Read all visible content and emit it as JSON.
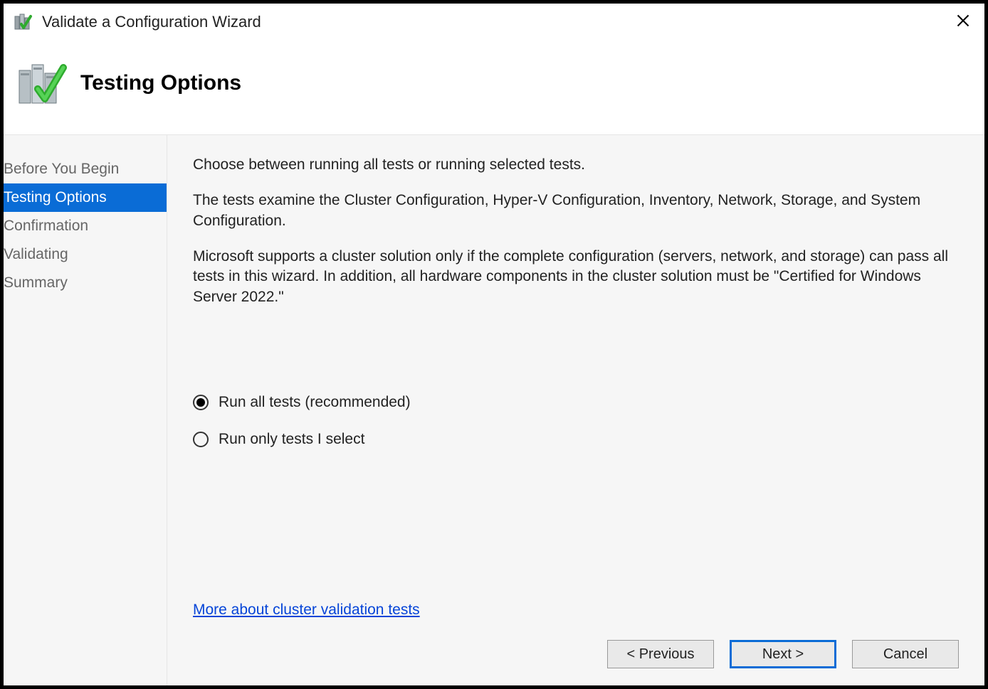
{
  "window": {
    "title": "Validate a Configuration Wizard"
  },
  "header": {
    "title": "Testing Options"
  },
  "sidebar": {
    "items": [
      {
        "label": "Before You Begin",
        "active": false
      },
      {
        "label": "Testing Options",
        "active": true
      },
      {
        "label": "Confirmation",
        "active": false
      },
      {
        "label": "Validating",
        "active": false
      },
      {
        "label": "Summary",
        "active": false
      }
    ]
  },
  "main": {
    "para1": "Choose between running all tests or running selected tests.",
    "para2": "The tests examine the Cluster Configuration, Hyper-V Configuration, Inventory, Network, Storage, and System Configuration.",
    "para3": "Microsoft supports a cluster solution only if the complete configuration (servers, network, and storage) can pass all tests in this wizard. In addition, all hardware components in the cluster solution must be \"Certified for Windows Server 2022.\"",
    "options": [
      {
        "label": "Run all tests (recommended)",
        "selected": true
      },
      {
        "label": "Run only tests I select",
        "selected": false
      }
    ],
    "more_link": "More about cluster validation tests"
  },
  "buttons": {
    "previous": "< Previous",
    "next": "Next >",
    "cancel": "Cancel"
  }
}
